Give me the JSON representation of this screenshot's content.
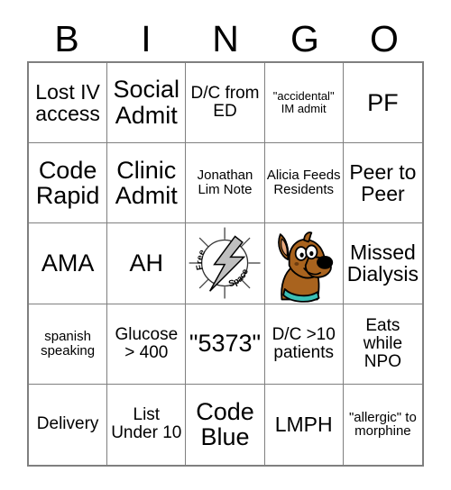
{
  "header": {
    "letters": [
      "B",
      "I",
      "N",
      "G",
      "O"
    ]
  },
  "grid": {
    "rows": [
      [
        {
          "text": "Lost IV access",
          "size": "lg"
        },
        {
          "text": "Social Admit",
          "size": "xl"
        },
        {
          "text": "D/C from ED",
          "size": "md"
        },
        {
          "text": "\"accidental\" IM admit",
          "size": "xs"
        },
        {
          "text": "PF",
          "size": "xl"
        }
      ],
      [
        {
          "text": "Code Rapid",
          "size": "xl"
        },
        {
          "text": "Clinic Admit",
          "size": "xl"
        },
        {
          "text": "Jonathan Lim Note",
          "size": "sm"
        },
        {
          "text": "Alicia Feeds Residents",
          "size": "sm"
        },
        {
          "text": "Peer to Peer",
          "size": "lg"
        }
      ],
      [
        {
          "text": "AMA",
          "size": "xl"
        },
        {
          "text": "AH",
          "size": "xl"
        },
        {
          "icon": "free-space-lightning",
          "free_label_top": "Free",
          "free_label_bottom": "Space"
        },
        {
          "icon": "scooby-doo-dog"
        },
        {
          "text": "Missed Dialysis",
          "size": "lg"
        }
      ],
      [
        {
          "text": "spanish speaking",
          "size": "sm"
        },
        {
          "text": "Glucose > 400",
          "size": "md"
        },
        {
          "text": "\"5373\"",
          "size": "xl"
        },
        {
          "text": "D/C >10 patients",
          "size": "md"
        },
        {
          "text": "Eats while NPO",
          "size": "md"
        }
      ],
      [
        {
          "text": "Delivery",
          "size": "md"
        },
        {
          "text": "List Under 10",
          "size": "md"
        },
        {
          "text": "Code Blue",
          "size": "xl"
        },
        {
          "text": "LMPH",
          "size": "lg"
        },
        {
          "text": "\"allergic\" to morphine",
          "size": "sm"
        }
      ]
    ]
  },
  "colors": {
    "border": "#7f7f7f",
    "text": "#000000",
    "background": "#ffffff",
    "bolt_fill": "#bfbfbf",
    "scooby_body": "#a9631e",
    "scooby_collar": "#3bbfb5",
    "scooby_nose": "#000000",
    "scooby_inner_ear": "#e8a87c"
  }
}
